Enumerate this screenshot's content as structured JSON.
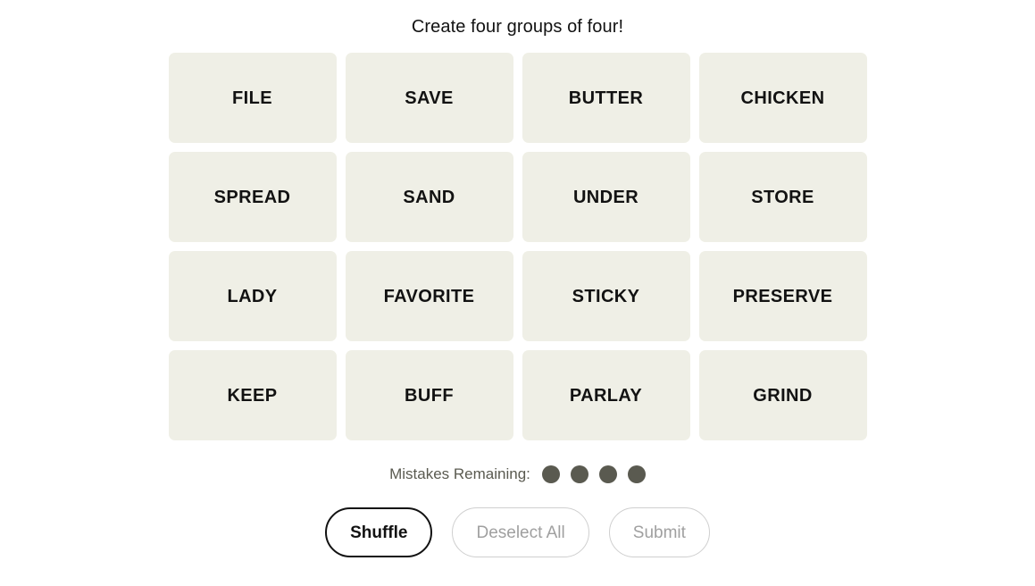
{
  "header": {
    "title": "Create four groups of four!"
  },
  "board": {
    "rows": 4,
    "cols": 4,
    "tiles": [
      {
        "label": "FILE"
      },
      {
        "label": "SAVE"
      },
      {
        "label": "BUTTER"
      },
      {
        "label": "CHICKEN"
      },
      {
        "label": "SPREAD"
      },
      {
        "label": "SAND"
      },
      {
        "label": "UNDER"
      },
      {
        "label": "STORE"
      },
      {
        "label": "LADY"
      },
      {
        "label": "FAVORITE"
      },
      {
        "label": "STICKY"
      },
      {
        "label": "PRESERVE"
      },
      {
        "label": "KEEP"
      },
      {
        "label": "BUFF"
      },
      {
        "label": "PARLAY"
      },
      {
        "label": "GRIND"
      }
    ]
  },
  "mistakes": {
    "label": "Mistakes Remaining:",
    "remaining": 4,
    "dots": [
      {
        "name": "mistake-dot-1"
      },
      {
        "name": "mistake-dot-2"
      },
      {
        "name": "mistake-dot-3"
      },
      {
        "name": "mistake-dot-4"
      }
    ]
  },
  "actions": {
    "shuffle_label": "Shuffle",
    "deselect_label": "Deselect All",
    "submit_label": "Submit"
  },
  "colors": {
    "page_background": "#ffffff",
    "tile_background": "#efefe6",
    "tile_text": "#121212",
    "dot": "#5a5a50",
    "muted_text": "#a0a0a0",
    "muted_border": "#cfcfcf",
    "active_border": "#121212"
  }
}
